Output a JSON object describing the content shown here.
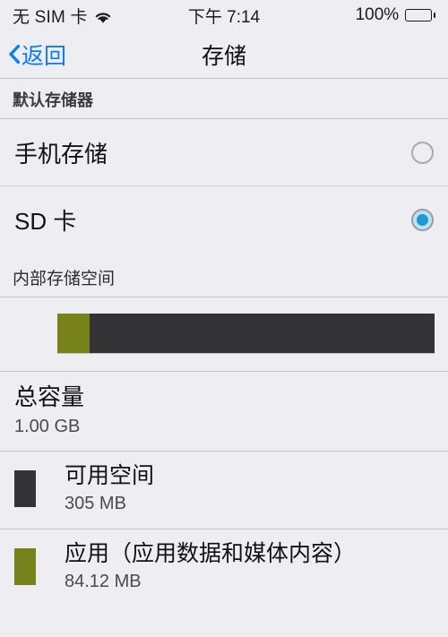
{
  "statusbar": {
    "carrier": "无 SIM 卡",
    "wifi_icon": "wifi-icon",
    "time": "下午 7:14",
    "battery_percent": "100%",
    "battery_icon": "battery-full-icon"
  },
  "navbar": {
    "back_label": "返回",
    "back_icon": "chevron-left-icon",
    "title": "存储"
  },
  "sections": {
    "default_storage": {
      "header": "默认存储器",
      "options": [
        {
          "label": "手机存储",
          "selected": false
        },
        {
          "label": "SD 卡",
          "selected": true
        }
      ]
    },
    "internal_storage": {
      "header": "内部存储空间",
      "total": {
        "label": "总容量",
        "value": "1.00 GB"
      },
      "items": [
        {
          "label": "可用空间",
          "value": "305 MB",
          "color": "#333336"
        },
        {
          "label": "应用（应用数据和媒体内容）",
          "value": "84.12 MB",
          "color": "#77821b"
        }
      ]
    }
  },
  "colors": {
    "accent": "#0a7cf5",
    "radio_on": "#1d9ad4",
    "bar_used": "#77821b",
    "bar_free": "#333336",
    "background": "#eeeef2",
    "separator": "#c3c3c7"
  },
  "chart_data": {
    "type": "bar",
    "title": "内部存储空间",
    "categories": [
      "应用（应用数据和媒体内容）",
      "可用空间"
    ],
    "values": [
      84.12,
      305
    ],
    "unit": "MB",
    "total": 1024,
    "total_label": "1.00 GB",
    "colors": [
      "#77821b",
      "#333336"
    ],
    "orientation": "horizontal-stacked"
  }
}
